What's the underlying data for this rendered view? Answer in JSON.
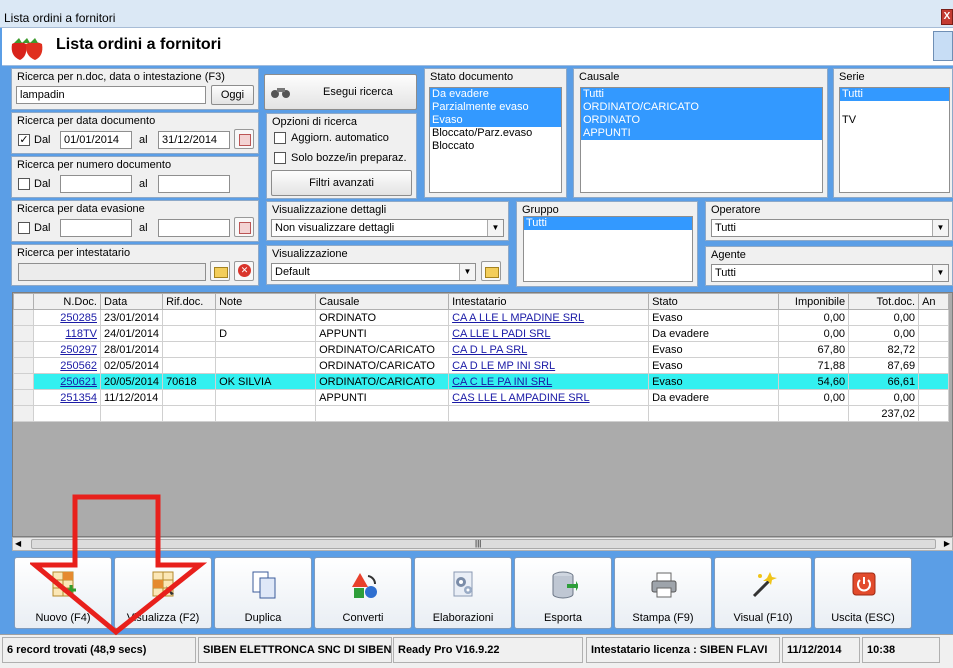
{
  "window": {
    "title": "Lista ordini a fornitori",
    "close": "X"
  },
  "header": {
    "title": "Lista ordini a fornitori"
  },
  "search": {
    "label": "Ricerca per n.doc, data o intestazione (F3)",
    "value": "lampadin",
    "today_button": "Oggi",
    "run_button": "Esegui ricerca"
  },
  "date_doc": {
    "label": "Ricerca per data documento",
    "checked": true,
    "from_label": "Dal",
    "from": "01/01/2014",
    "to_label": "al",
    "to": "31/12/2014"
  },
  "num_doc": {
    "label": "Ricerca per numero documento",
    "from_label": "Dal",
    "to_label": "al"
  },
  "date_ev": {
    "label": "Ricerca per data evasione",
    "from_label": "Dal",
    "to_label": "al"
  },
  "owner": {
    "label": "Ricerca per intestatario"
  },
  "options": {
    "label": "Opzioni di ricerca",
    "auto_update": "Aggiorn. automatico",
    "drafts_only": "Solo bozze/in preparaz.",
    "advanced": "Filtri avanzati"
  },
  "details": {
    "label": "Visualizzazione dettagli",
    "value": "Non visualizzare dettagli"
  },
  "view": {
    "label": "Visualizzazione",
    "value": "Default"
  },
  "stato": {
    "label": "Stato documento",
    "items": [
      {
        "text": "Da evadere",
        "selected": true
      },
      {
        "text": "Parzialmente evaso",
        "selected": true
      },
      {
        "text": "Evaso",
        "selected": true
      },
      {
        "text": "Bloccato/Parz.evaso",
        "selected": false
      },
      {
        "text": "Bloccato",
        "selected": false
      }
    ]
  },
  "causale": {
    "label": "Causale",
    "items": [
      {
        "text": "Tutti",
        "selected": true
      },
      {
        "text": "ORDINATO/CARICATO",
        "selected": true
      },
      {
        "text": "ORDINATO",
        "selected": true
      },
      {
        "text": "APPUNTI",
        "selected": true
      }
    ]
  },
  "serie": {
    "label": "Serie",
    "items": [
      {
        "text": "Tutti",
        "selected": true
      },
      {
        "text": "",
        "selected": false
      },
      {
        "text": "TV",
        "selected": false
      }
    ]
  },
  "gruppo": {
    "label": "Gruppo",
    "items": [
      {
        "text": "Tutti",
        "selected": true
      }
    ]
  },
  "operatore": {
    "label": "Operatore",
    "value": "Tutti"
  },
  "agente": {
    "label": "Agente",
    "value": "Tutti"
  },
  "table": {
    "columns": [
      "N.Doc.",
      "Data",
      "Rif.doc.",
      "Note",
      "Causale",
      "Intestatario",
      "Stato",
      "Imponibile",
      "Tot.doc.",
      "An"
    ],
    "rows": [
      {
        "ndoc": "250285",
        "data": "23/01/2014",
        "rif": "",
        "note": "",
        "causale": "ORDINATO",
        "intestatario": "CA    A    LLE L    MPADINE SRL",
        "stato": "Evaso",
        "imponibile": "0,00",
        "totdoc": "0,00",
        "highlight": false
      },
      {
        "ndoc": "118TV",
        "data": "24/01/2014",
        "rif": "",
        "note": "D",
        "causale": "APPUNTI",
        "intestatario": "CA      LLE L      PADI   SRL",
        "stato": "Da evadere",
        "imponibile": "0,00",
        "totdoc": "0,00",
        "highlight": false
      },
      {
        "ndoc": "250297",
        "data": "28/01/2014",
        "rif": "",
        "note": "",
        "causale": "ORDINATO/CARICATO",
        "intestatario": "CA    D    L      PA      SRL",
        "stato": "Evaso",
        "imponibile": "67,80",
        "totdoc": "82,72",
        "highlight": false
      },
      {
        "ndoc": "250562",
        "data": "02/05/2014",
        "rif": "",
        "note": "",
        "causale": "ORDINATO/CARICATO",
        "intestatario": "CA    D    LE   MP    INI   SRL",
        "stato": "Evaso",
        "imponibile": "71,88",
        "totdoc": "87,69",
        "highlight": false
      },
      {
        "ndoc": "250621",
        "data": "20/05/2014",
        "rif": "70618",
        "note": "OK SILVIA",
        "causale": "ORDINATO/CARICATO",
        "intestatario": "CA    C    LE   PA     INI   SRL",
        "stato": "Evaso",
        "imponibile": "54,60",
        "totdoc": "66,61",
        "highlight": true
      },
      {
        "ndoc": "251354",
        "data": "11/12/2014",
        "rif": "",
        "note": "",
        "causale": "APPUNTI",
        "intestatario": "CAS      LLE L    AMPADINE SRL",
        "stato": "Da evadere",
        "imponibile": "0,00",
        "totdoc": "0,00",
        "highlight": false
      }
    ],
    "total": "237,02"
  },
  "toolbar": [
    {
      "name": "nuovo",
      "label": "Nuovo (F4)"
    },
    {
      "name": "visualizza",
      "label": "Visualizza (F2)"
    },
    {
      "name": "duplica",
      "label": "Duplica"
    },
    {
      "name": "converti",
      "label": "Converti"
    },
    {
      "name": "elaborazioni",
      "label": "Elaborazioni"
    },
    {
      "name": "esporta",
      "label": "Esporta"
    },
    {
      "name": "stampa",
      "label": "Stampa (F9)"
    },
    {
      "name": "visual",
      "label": "Visual (F10)"
    },
    {
      "name": "uscita",
      "label": "Uscita (ESC)"
    }
  ],
  "status": {
    "records": "6 record trovati (48,9 secs)",
    "company": "SIBEN ELETTRONCA SNC DI SIBEN F",
    "version": "Ready Pro V16.9.22",
    "license": "Intestatario licenza : SIBEN FLAVI",
    "date": "11/12/2014",
    "time": "10:38"
  },
  "colors": {
    "background": "#5b9ee6",
    "selection": "#3399ff",
    "row_highlight": "#33f0f0",
    "arrow": "#e8201c"
  }
}
